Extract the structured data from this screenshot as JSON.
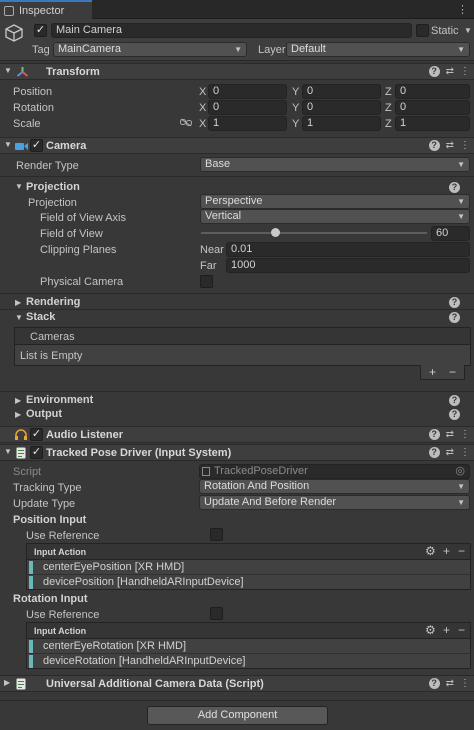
{
  "window": {
    "tab_label": "Inspector"
  },
  "gameobject": {
    "active": true,
    "name": "Main Camera",
    "static_label": "Static",
    "static_checked": false,
    "tag_label": "Tag",
    "tag_value": "MainCamera",
    "layer_label": "Layer",
    "layer_value": "Default"
  },
  "transform": {
    "title": "Transform",
    "position_label": "Position",
    "rotation_label": "Rotation",
    "scale_label": "Scale",
    "axis_x": "X",
    "axis_y": "Y",
    "axis_z": "Z",
    "position": [
      "0",
      "0",
      "0"
    ],
    "rotation": [
      "0",
      "0",
      "0"
    ],
    "scale": [
      "1",
      "1",
      "1"
    ]
  },
  "camera": {
    "title": "Camera",
    "render_type_label": "Render Type",
    "render_type": "Base",
    "projection_section": "Projection",
    "projection_label": "Projection",
    "projection": "Perspective",
    "fov_axis_label": "Field of View Axis",
    "fov_axis": "Vertical",
    "fov_label": "Field of View",
    "fov_value": "60",
    "fov_slider_fraction": 0.33,
    "clipping_label": "Clipping Planes",
    "near_label": "Near",
    "near_value": "0.01",
    "far_label": "Far",
    "far_value": "1000",
    "physical_label": "Physical Camera",
    "rendering_section": "Rendering",
    "stack_section": "Stack",
    "cameras_header": "Cameras",
    "list_empty": "List is Empty",
    "environment_section": "Environment",
    "output_section": "Output"
  },
  "audio_listener": {
    "title": "Audio Listener"
  },
  "tracked_pose": {
    "title": "Tracked Pose Driver (Input System)",
    "script_label": "Script",
    "script_value": "TrackedPoseDriver",
    "tracking_type_label": "Tracking Type",
    "tracking_type": "Rotation And Position",
    "update_type_label": "Update Type",
    "update_type": "Update And Before Render",
    "position_input_label": "Position Input",
    "use_reference_label": "Use Reference",
    "input_action_label": "Input Action",
    "position_bindings": [
      "centerEyePosition [XR HMD]",
      "devicePosition [HandheldARInputDevice]"
    ],
    "rotation_input_label": "Rotation Input",
    "rotation_use_reference_label": "Use Reference",
    "rotation_input_action_label": "Input Action",
    "rotation_bindings": [
      "centerEyeRotation [XR HMD]",
      "deviceRotation [HandheldARInputDevice]"
    ]
  },
  "ua_camera_data": {
    "title": "Universal Additional Camera Data (Script)"
  },
  "footer": {
    "add_component": "Add Component"
  },
  "icons": {
    "check": "✓",
    "fold_open": "▼",
    "fold_closed": "▶",
    "help": "?",
    "settings": "⇄",
    "more": "⋮",
    "plus": "+",
    "minus": "−",
    "gear": "⚙"
  }
}
